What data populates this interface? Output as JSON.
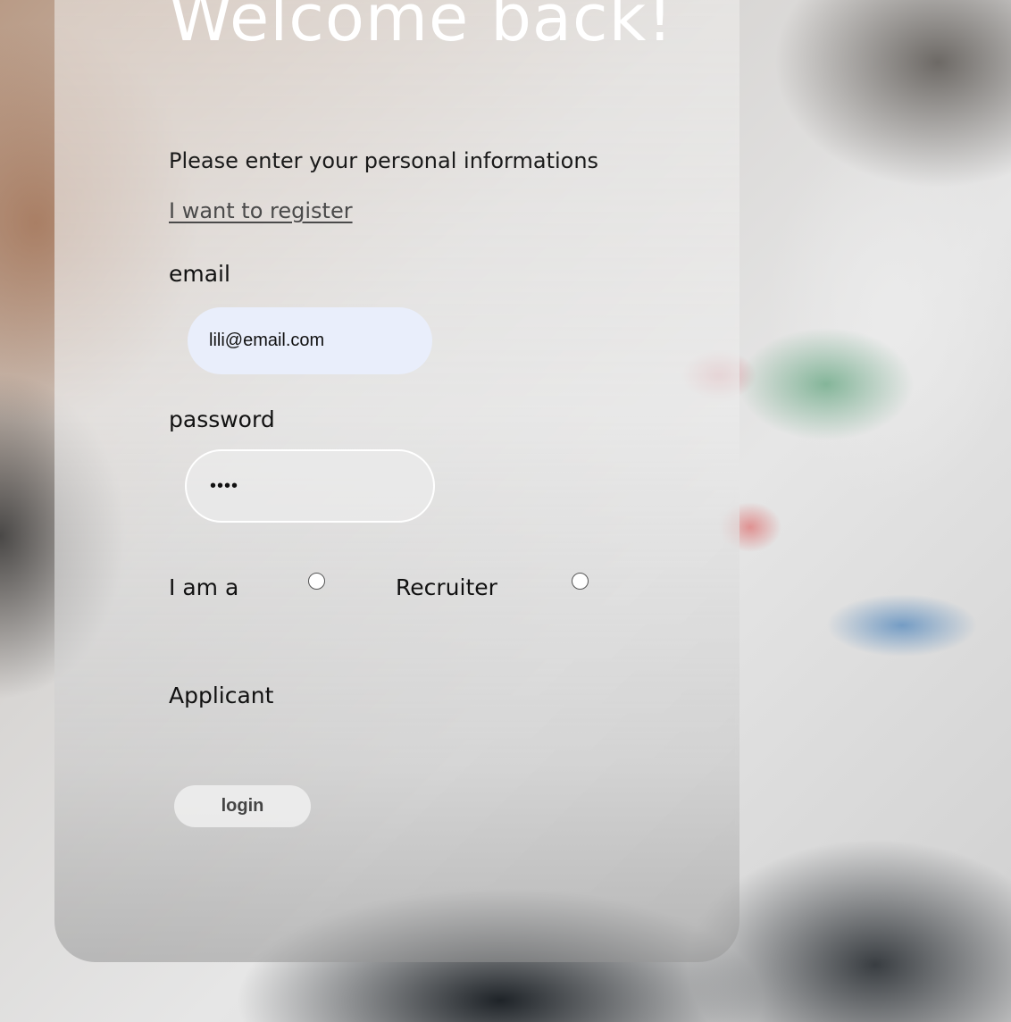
{
  "header": {
    "title": "Welcome back!",
    "subtitle": "Please enter your personal informations"
  },
  "register_link": "I want to register",
  "email": {
    "label": "email",
    "value": "lili@email.com"
  },
  "password": {
    "label": "password",
    "value": "••••"
  },
  "role": {
    "prefix": "I am a",
    "options": [
      "Applicant",
      "Recruiter"
    ]
  },
  "login_label": "login"
}
